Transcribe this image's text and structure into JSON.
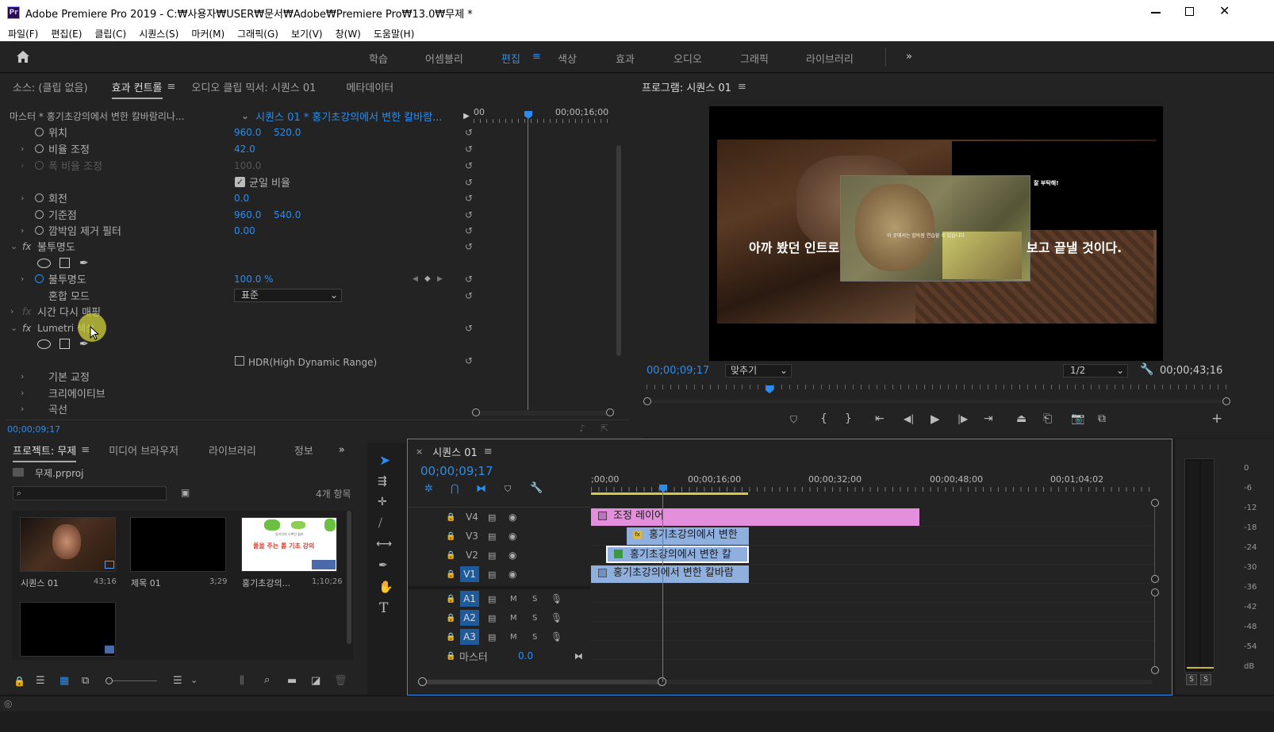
{
  "window": {
    "title": "Adobe Premiere Pro 2019 - C:₩사용자₩USER₩문서₩Adobe₩Premiere Pro₩13.0₩무제 *",
    "app_icon": "Pr"
  },
  "menu": [
    "파일(F)",
    "편집(E)",
    "클립(C)",
    "시퀀스(S)",
    "마커(M)",
    "그래픽(G)",
    "보기(V)",
    "창(W)",
    "도움말(H)"
  ],
  "workspaces": [
    "학습",
    "어셈블리",
    "편집",
    "색상",
    "효과",
    "오디오",
    "그래픽",
    "라이브러리"
  ],
  "active_workspace": "편집",
  "top_left_panel": {
    "tabs": [
      "소스: (클립 없음)",
      "효과 컨트롤",
      "오디오 클립 믹서: 시퀀스 01",
      "메타데이터"
    ],
    "active_tab": "효과 컨트롤",
    "master_label": "마스터 * 홍기초강의에서 변한 칼바람리나...",
    "sequence_label": "시퀀스 01 * 홍기초강의에서 변한 칼바람...",
    "ruler_start": "00",
    "ruler_mid": "00;00;16;00",
    "timecode": "00;00;09;17",
    "rows": {
      "position": {
        "label": "위치",
        "v1": "960.0",
        "v2": "520.0"
      },
      "scale": {
        "label": "비율 조정",
        "v1": "42.0"
      },
      "scale_width": {
        "label": "폭 비율 조정",
        "v1": "100.0"
      },
      "uniform": {
        "label": "균일 비율"
      },
      "rotation": {
        "label": "회전",
        "v1": "0.0"
      },
      "anchor": {
        "label": "기준점",
        "v1": "960.0",
        "v2": "540.0"
      },
      "antiflicker": {
        "label": "깜박임 제거 필터",
        "v1": "0.00"
      },
      "opacity_fx": {
        "label": "불투명도"
      },
      "opacity": {
        "label": "불투명도",
        "v1": "100.0 %"
      },
      "blend": {
        "label": "혼합 모드",
        "v1": "표준"
      },
      "time_remap": {
        "label": "시간 다시 매핑"
      },
      "lumetri": {
        "label": "Lumetri 색상"
      },
      "hdr": {
        "label": "HDR(High Dynamic Range)"
      },
      "basic": {
        "label": "기본 교정"
      },
      "creative": {
        "label": "크리에이티브"
      },
      "curves": {
        "label": "곡선"
      }
    }
  },
  "program_monitor": {
    "title": "프로그램: 시퀀스 01",
    "timecode_current": "00;00;09;17",
    "fit": "맞추기",
    "resolution": "1/2",
    "timecode_duration": "00;00;43;16",
    "caption_left": "아까 봤던 인트로",
    "caption_right": "보고 끝낼 것이다.",
    "overlay_small_text": "이 곳에서는 칼바람 연습할 수 있습니다",
    "overlay_right_text": "잘 부탁해!"
  },
  "project_panel": {
    "tabs": [
      "프로젝트: 무제",
      "미디어 브라우저",
      "라이브러리",
      "정보"
    ],
    "file": "무제.prproj",
    "count": "4개 항목",
    "items": [
      {
        "name": "시퀀스 01",
        "duration": "43;16"
      },
      {
        "name": "제목 01",
        "duration": "3;29"
      },
      {
        "name": "홍기초강의...",
        "duration": "1;10;26"
      }
    ],
    "thumb3_text_top": "탑라인의 나쁘던 월초",
    "thumb3_text_main": "풀을 주는 롤 기초 강의"
  },
  "timeline": {
    "title": "시퀀스 01",
    "timecode": "00;00;09;17",
    "ruler": [
      ";00;00",
      "00;00;16;00",
      "00;00;32;00",
      "00;00;48;00",
      "00;01;04;02"
    ],
    "video_tracks": [
      "V4",
      "V3",
      "V2",
      "V1"
    ],
    "audio_tracks": [
      "A1",
      "A2",
      "A3"
    ],
    "master_label": "마스터",
    "master_value": "0.0",
    "mute": "M",
    "solo": "S",
    "clips": {
      "v4": "조정 레이어",
      "v3": "홍기초강의에서 변한",
      "v2": "홍기초강의에서 변한 칼",
      "v1": "홍기초강의에서 변한 칼바람"
    }
  },
  "audio_meter": {
    "scale": [
      "0",
      "-6",
      "-12",
      "-18",
      "-24",
      "-30",
      "-36",
      "-42",
      "-48",
      "-54",
      "dB"
    ],
    "solo_left": "S",
    "solo_right": "S"
  },
  "colors": {
    "accent": "#2d8ceb",
    "adjustment_clip": "#e38fdc",
    "video_clip": "#8fb0de",
    "panel_bg": "#232323"
  }
}
